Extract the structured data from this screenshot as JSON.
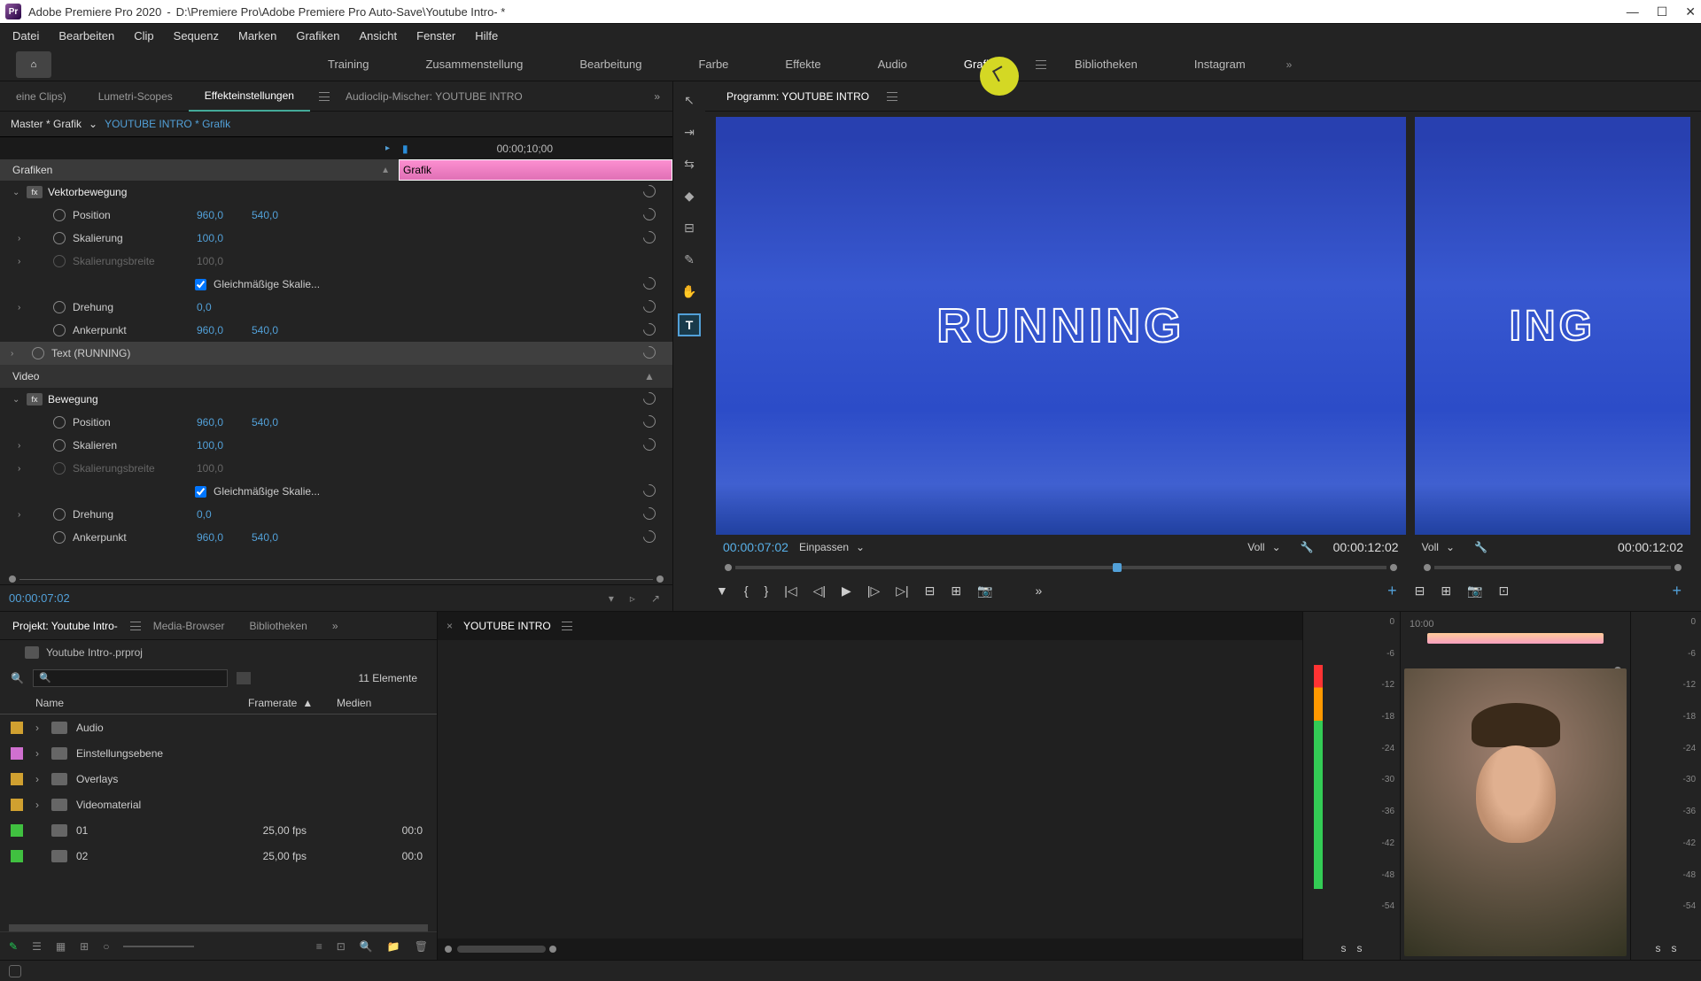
{
  "titlebar": {
    "app": "Adobe Premiere Pro 2020",
    "path": "D:\\Premiere Pro\\Adobe Premiere Pro Auto-Save\\Youtube Intro- *"
  },
  "menu": [
    "Datei",
    "Bearbeiten",
    "Clip",
    "Sequenz",
    "Marken",
    "Grafiken",
    "Ansicht",
    "Fenster",
    "Hilfe"
  ],
  "workspaces": [
    "Training",
    "Zusammenstellung",
    "Bearbeitung",
    "Farbe",
    "Effekte",
    "Audio",
    "Grafiken",
    "Bibliotheken",
    "Instagram"
  ],
  "home_icon": "⌂ 0\n.dg",
  "effect_tabs": {
    "clips": "eine Clips)",
    "lumetri": "Lumetri-Scopes",
    "settings": "Effekteinstellungen",
    "aclip": "Audioclip-Mischer: YOUTUBE INTRO"
  },
  "ec": {
    "master": "Master * Grafik",
    "link": "YOUTUBE INTRO * Grafik",
    "tc": "00:00;10;00",
    "grafik_clip": "Grafik",
    "cat_grafiken": "Grafiken",
    "vektor": "Vektorbewegung",
    "position": "Position",
    "position_v": "960,0",
    "position_v2": "540,0",
    "skalierung": "Skalierung",
    "skalierung_v": "100,0",
    "skalbreite": "Skalierungsbreite",
    "skalbreite_v": "100,0",
    "gleich": "Gleichmäßige Skalie...",
    "drehung": "Drehung",
    "drehung_v": "0,0",
    "anker": "Ankerpunkt",
    "anker_v": "960,0",
    "anker_v2": "540,0",
    "text_layer": "Text (RUNNING)",
    "cat_video": "Video",
    "bewegung": "Bewegung",
    "skalieren": "Skalieren",
    "foot_tc": "00:00:07:02"
  },
  "program": {
    "tab": "Programm: YOUTUBE INTRO",
    "overlay": "RUNNING",
    "overlay2": "ING",
    "tc_cur": "00:00:07:02",
    "fit": "Einpassen",
    "res": "Voll",
    "tc_dur": "00:00:12:02",
    "tc_cur2": "",
    "res2": "Voll",
    "tc_dur2": "00:00:12:02"
  },
  "project": {
    "tabs": {
      "p": "Projekt: Youtube Intro-",
      "mb": "Media-Browser",
      "bib": "Bibliotheken"
    },
    "filename": "Youtube Intro-.prproj",
    "count": "11 Elemente",
    "cols": {
      "n": "Name",
      "fr": "Framerate",
      "md": "Medien"
    },
    "rows": [
      {
        "c": "#d0a030",
        "name": "Audio",
        "fr": "",
        "md": ""
      },
      {
        "c": "#d070d0",
        "name": "Einstellungsebene",
        "fr": "",
        "md": ""
      },
      {
        "c": "#d0a030",
        "name": "Overlays",
        "fr": "",
        "md": ""
      },
      {
        "c": "#d0a030",
        "name": "Videomaterial",
        "fr": "",
        "md": ""
      },
      {
        "c": "#40c040",
        "name": "01",
        "fr": "25,00 fps",
        "md": "00:0"
      },
      {
        "c": "#40c040",
        "name": "02",
        "fr": "25,00 fps",
        "md": "00:0"
      }
    ]
  },
  "timeline": {
    "name": "YOUTUBE INTRO"
  },
  "mini": {
    "tc": "10:00"
  },
  "meters": {
    "scale": [
      "0",
      "-6",
      "-12",
      "-18",
      "-24",
      "-30",
      "-36",
      "-42",
      "-48",
      "-54",
      ""
    ],
    "solo": "s"
  },
  "search_ph": "🔍"
}
